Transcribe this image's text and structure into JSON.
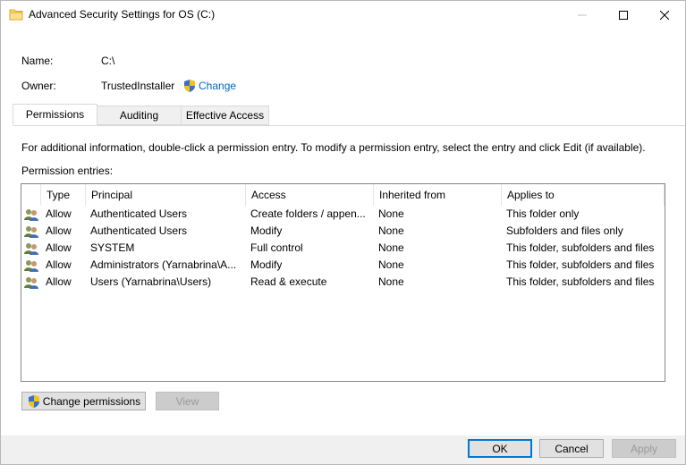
{
  "window": {
    "title": "Advanced Security Settings for OS (C:)"
  },
  "info": {
    "name_label": "Name:",
    "name_value": "C:\\",
    "owner_label": "Owner:",
    "owner_value": "TrustedInstaller",
    "change_link": "Change"
  },
  "tabs": [
    {
      "label": "Permissions",
      "active": true
    },
    {
      "label": "Auditing",
      "active": false
    },
    {
      "label": "Effective Access",
      "active": false
    }
  ],
  "instructions": "For additional information, double-click a permission entry. To modify a permission entry, select the entry and click Edit (if available).",
  "entries_label": "Permission entries:",
  "columns": [
    "Type",
    "Principal",
    "Access",
    "Inherited from",
    "Applies to"
  ],
  "rows": [
    {
      "type": "Allow",
      "principal": "Authenticated Users",
      "access": "Create folders / appen...",
      "inherited": "None",
      "applies": "This folder only"
    },
    {
      "type": "Allow",
      "principal": "Authenticated Users",
      "access": "Modify",
      "inherited": "None",
      "applies": "Subfolders and files only"
    },
    {
      "type": "Allow",
      "principal": "SYSTEM",
      "access": "Full control",
      "inherited": "None",
      "applies": "This folder, subfolders and files"
    },
    {
      "type": "Allow",
      "principal": "Administrators (Yarnabrina\\A...",
      "access": "Modify",
      "inherited": "None",
      "applies": "This folder, subfolders and files"
    },
    {
      "type": "Allow",
      "principal": "Users (Yarnabrina\\Users)",
      "access": "Read & execute",
      "inherited": "None",
      "applies": "This folder, subfolders and files"
    }
  ],
  "buttons": {
    "change_permissions": "Change permissions",
    "view": "View",
    "ok": "OK",
    "cancel": "Cancel",
    "apply": "Apply"
  },
  "colors": {
    "link": "#0066cc",
    "default_button_border": "#0078d7"
  }
}
